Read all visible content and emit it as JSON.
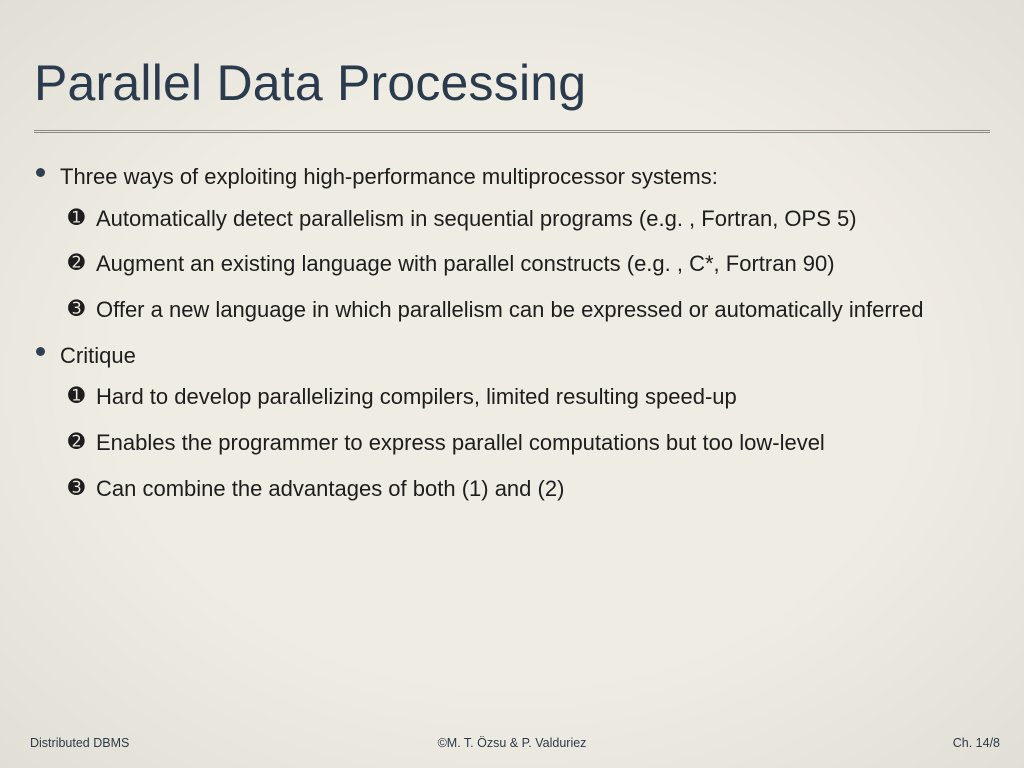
{
  "title": "Parallel Data Processing",
  "bullets": [
    {
      "lead": "Three ways of exploiting high-performance multiprocessor systems:",
      "items": [
        "Automatically detect parallelism in sequential programs (e.g. , Fortran, OPS 5)",
        "Augment an existing language with parallel constructs (e.g. , C*, Fortran 90)",
        "Offer a new language in which parallelism can be expressed or automatically inferred"
      ]
    },
    {
      "lead": "Critique",
      "items": [
        "Hard to develop parallelizing compilers, limited resulting speed-up",
        "Enables the programmer to express parallel computations but too low-level",
        "Can combine the advantages of both (1) and (2)"
      ]
    }
  ],
  "numerals": [
    "➊",
    "➋",
    "➌"
  ],
  "footer": {
    "left": "Distributed DBMS",
    "center": "©M. T. Özsu & P. Valduriez",
    "right": "Ch. 14/8"
  }
}
